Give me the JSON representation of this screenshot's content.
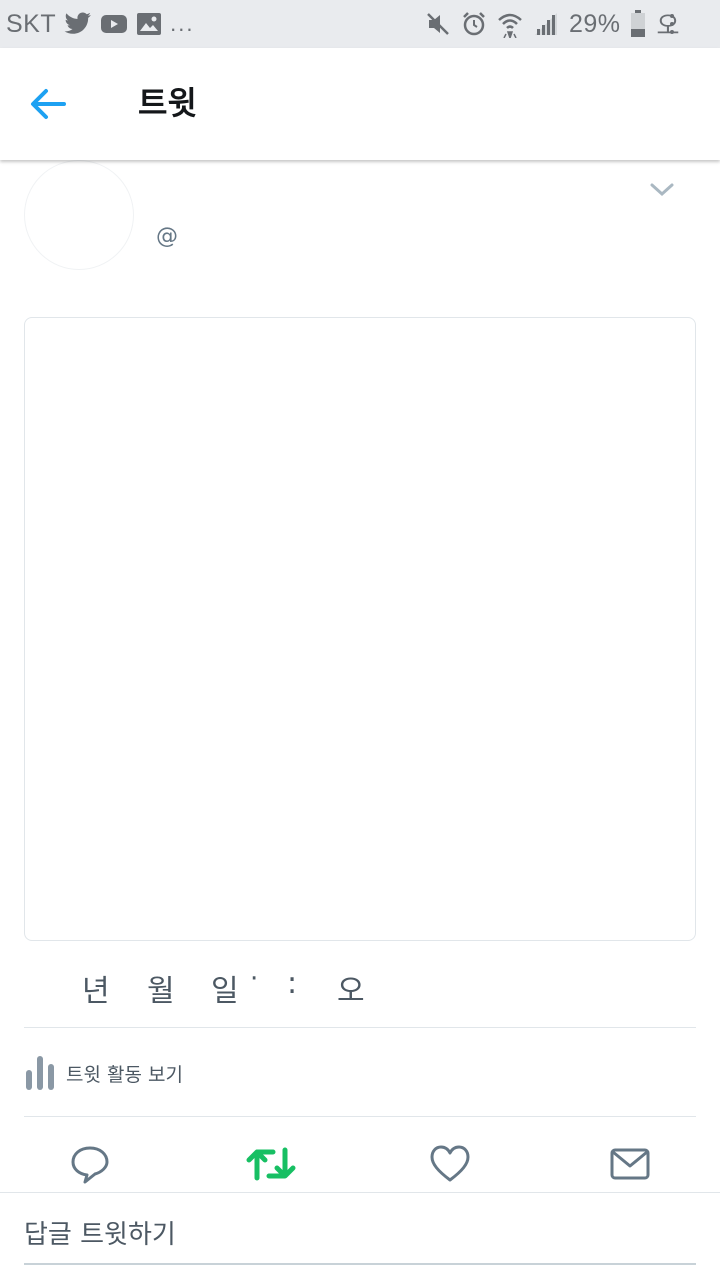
{
  "status_bar": {
    "carrier": "SKT",
    "more": "...",
    "battery_percent": "29%",
    "clock_partial": "오"
  },
  "header": {
    "title": "트윗"
  },
  "tweet": {
    "handle": "@",
    "timestamp": {
      "year_unit": "년",
      "month_unit": "월",
      "day_unit": "일",
      "sep_dot": "·",
      "colon": ":",
      "ampm": "오"
    },
    "analytics_label": "트윗 활동 보기",
    "retweeted": true
  },
  "reply": {
    "placeholder": "답글 트윗하기"
  },
  "colors": {
    "accent": "#1da1f2",
    "retweet_active": "#17bf63",
    "icon_gray": "#657786",
    "status_bar_bg": "#e9ebee"
  }
}
